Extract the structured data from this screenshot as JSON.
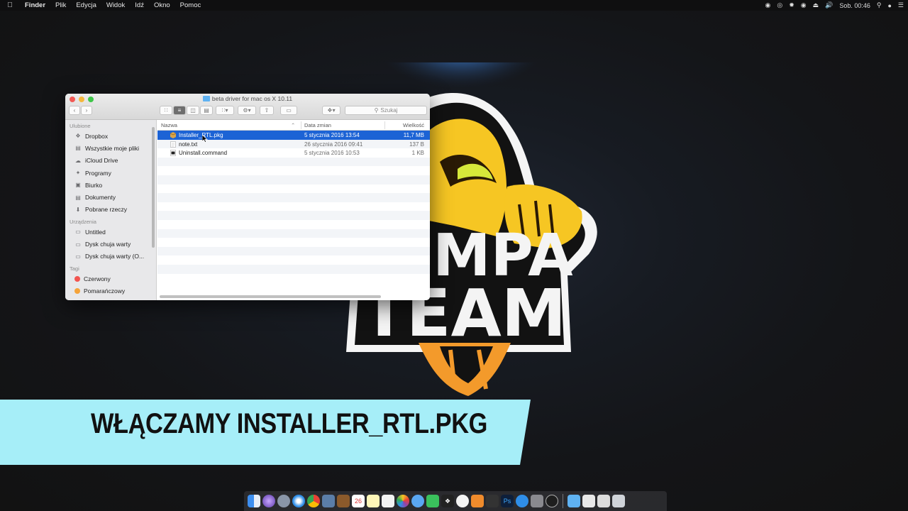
{
  "menubar": {
    "apple": "",
    "app": "Finder",
    "menus": [
      "Plik",
      "Edycja",
      "Widok",
      "Idź",
      "Okno",
      "Pomoc"
    ],
    "status_icons": [
      "record-icon",
      "headset-icon",
      "settings-icon",
      "nvidia-icon",
      "eject-icon",
      "volume-icon"
    ],
    "clock": "Sob. 00:46"
  },
  "background": {
    "logo_text_1": "MPA",
    "logo_text_2": "TEAM",
    "colors": {
      "shield": "#f6c623",
      "glow": "#5fa6ff",
      "flames": "#f39a2b"
    }
  },
  "finder": {
    "title": "beta driver for mac os X 10.11",
    "search_placeholder": "Szukaj",
    "sidebar": {
      "favorites_header": "Ulubione",
      "favorites": [
        {
          "label": "Dropbox",
          "icon": "dropbox-icon"
        },
        {
          "label": "Wszystkie moje pliki",
          "icon": "all-files-icon"
        },
        {
          "label": "iCloud Drive",
          "icon": "cloud-icon"
        },
        {
          "label": "Programy",
          "icon": "applications-icon"
        },
        {
          "label": "Biurko",
          "icon": "desktop-icon"
        },
        {
          "label": "Dokumenty",
          "icon": "documents-icon"
        },
        {
          "label": "Pobrane rzeczy",
          "icon": "downloads-icon"
        }
      ],
      "devices_header": "Urządzenia",
      "devices": [
        {
          "label": "Untitled",
          "icon": "disk-icon"
        },
        {
          "label": "Dysk chuja warty",
          "icon": "disk-icon"
        },
        {
          "label": "Dysk chuja warty (O...",
          "icon": "disk-icon"
        }
      ],
      "tags_header": "Tagi",
      "tags": [
        {
          "label": "Czerwony",
          "color": "#f2544f"
        },
        {
          "label": "Pomarańczowy",
          "color": "#f5a33a"
        }
      ]
    },
    "columns": {
      "name": "Nazwa",
      "date": "Data zmian",
      "size": "Wielkość"
    },
    "files": [
      {
        "name": "Installer_RTL.pkg",
        "date": "5 stycznia 2016 13:54",
        "size": "11,7 MB",
        "icon": "package-icon",
        "selected": true
      },
      {
        "name": "note.txt",
        "date": "26 stycznia 2016 09:41",
        "size": "137 B",
        "icon": "text-file-icon",
        "selected": false
      },
      {
        "name": "Uninstall.command",
        "date": "5 stycznia 2016 10:53",
        "size": "1 KB",
        "icon": "terminal-file-icon",
        "selected": false
      }
    ]
  },
  "banner": {
    "text": "WŁĄCZAMY INSTALLER_RTL.PKG",
    "color": "#a6eef8"
  }
}
